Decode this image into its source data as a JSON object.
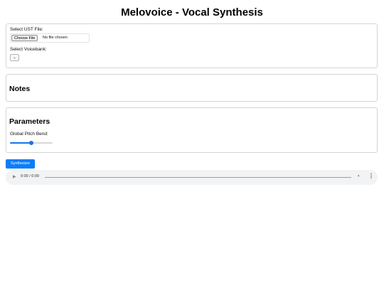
{
  "app": {
    "title": "Melovoice - Vocal Synthesis"
  },
  "file_panel": {
    "ust_label": "Select UST File:",
    "choose_file_label": "Choose File",
    "file_status": "No file chosen",
    "voicebank_label": "Select Voicebank:",
    "voicebank_selected": ""
  },
  "notes_panel": {
    "heading": "Notes"
  },
  "params_panel": {
    "heading": "Parameters",
    "pitch_label": "Global Pitch Bend:",
    "pitch_value_fraction": 0.5
  },
  "synthesize_label": "Synthesize",
  "audio": {
    "time": "0:00 / 0:00",
    "icons": {
      "play": "play-icon",
      "volume": "volume-icon",
      "more": "more-vertical-icon"
    }
  },
  "colors": {
    "accent": "#0b7dfa",
    "slider": "#1a73e8",
    "panel_border": "#d4d4d4",
    "audio_bg": "#f1f3f4"
  }
}
